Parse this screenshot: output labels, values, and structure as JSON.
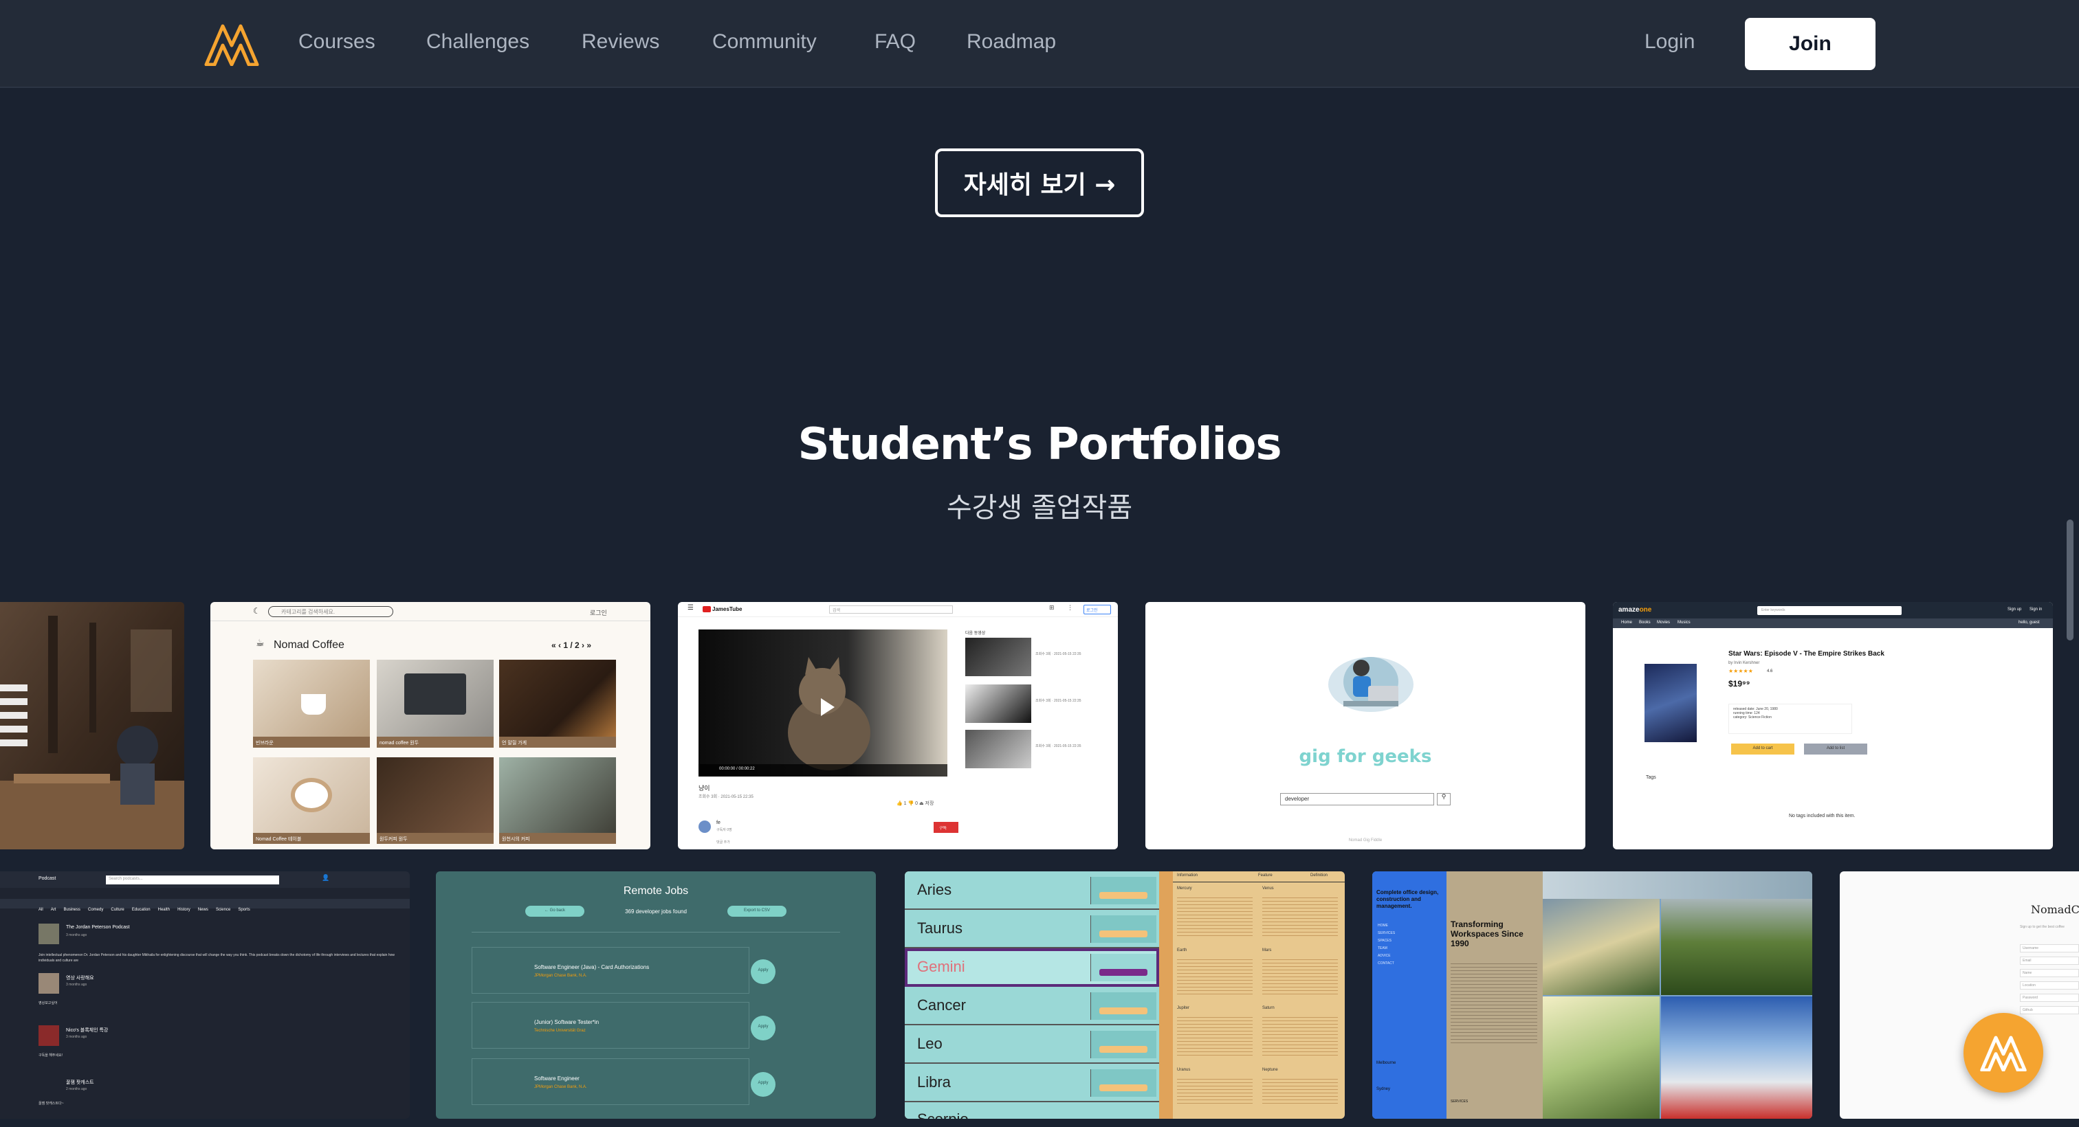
{
  "nav": {
    "links": [
      "Courses",
      "Challenges",
      "Reviews",
      "Community",
      "FAQ",
      "Roadmap"
    ],
    "login": "Login",
    "join": "Join"
  },
  "more_button": "자세히 보기 →",
  "section": {
    "title": "Student’s Portfolios",
    "subtitle": "수강생 졸업작품"
  },
  "colors": {
    "background": "#1a2230",
    "nav_background": "#232b38",
    "accent": "#f5a430"
  },
  "cards": {
    "nomad_coffee": {
      "search_placeholder": "카테고리를 검색하세요.",
      "login": "로그인",
      "title": "Nomad Coffee",
      "pager": "« ‹ 1 / 2 › »",
      "captions": [
        "빈브라운",
        "nomad coffee 원두",
        "언 말릴 가게",
        "Nomad Coffee 테이블",
        "원두커피 원두",
        "원천시의 커피"
      ]
    },
    "jamestube": {
      "logo": "JamesTube",
      "search": "검색",
      "login": "로그인",
      "video_title": "냥이",
      "video_meta": "조회수 3회 · 2021-05-15 22:35",
      "time": "00:00:00 / 00:00:22",
      "channel": "fe",
      "subscribers": "구독자 0명",
      "sidebar_title": "다음 동영상",
      "sidebar_meta": "조회수 3회 · 2021-05-15 22:35",
      "subscribe": "구독",
      "comment_hint": "댓글 추가",
      "actions": "👍 1  👎 0  ⏏ 저장"
    },
    "gig_for_geeks": {
      "title": "gig for geeks",
      "search_value": "developer",
      "footer": "Nomad Gig Fiddle"
    },
    "amazeone": {
      "logo_pre": "amaze",
      "logo_post": "one",
      "search": "Enter keywords",
      "nav_links": [
        "Home",
        "Books",
        "Movies",
        "Musics"
      ],
      "signup": "Sign up",
      "signin": "Sign in",
      "hello": "hello, guest",
      "product_title": "Star Wars: Episode V - The Empire Strikes Back",
      "author": "by Irvin Kershner",
      "rating": "4.6",
      "price": "$19⁹⁹",
      "details": [
        "released date: June 20, 1980",
        "running time: 124",
        "category: Science Fiction"
      ],
      "add_to_cart": "Add to cart",
      "add_to_list": "Add to list",
      "tags": "Tags",
      "no_tags": "No tags included with this item."
    },
    "podcast": {
      "brand": "Podcast",
      "search": "Search podcasts...",
      "categories": [
        "All",
        "Art",
        "Business",
        "Comedy",
        "Culture",
        "Education",
        "Health",
        "History",
        "News",
        "Science",
        "Sports"
      ],
      "items": [
        {
          "title": "The Jordan Peterson Podcast",
          "ago": "3 months ago",
          "desc": "Join intellectual phenomenon Dr. Jordan Peterson and his daughter Mikhaila for enlightening discourse that will change the way you think. This podcast breaks down the dichotomy of life through interviews and lectures that explain how individuals and culture are"
        },
        {
          "title": "영상 사랑해요",
          "ago": "3 months ago",
          "desc": "영상보고싶어"
        },
        {
          "title": "Nico's 블록체인 특강",
          "ago": "3 months ago",
          "desc": "구독을 해주세요!"
        },
        {
          "title": "꿀잼 팟캐스트",
          "ago": "2 months ago",
          "desc": "꿀잼 팟캐스트다~"
        }
      ]
    },
    "remote_jobs": {
      "title": "Remote Jobs",
      "go_back": "← Go back",
      "count": "369 developer jobs found",
      "export": "Export to CSV",
      "jobs": [
        {
          "title": "Software Engineer (Java) - Card Authorizations",
          "company": "JPMorgan Chase Bank, N.A."
        },
        {
          "title": "(Junior) Software Tester*in",
          "company": "Technische Universität Graz"
        },
        {
          "title": "Software Engineer",
          "company": "JPMorgan Chase Bank, N.A."
        }
      ],
      "apply": "Apply"
    },
    "zodiac": {
      "signs": [
        "Aries",
        "Taurus",
        "Gemini",
        "Cancer",
        "Leo",
        "Libra",
        "Scorpio"
      ],
      "tabs": [
        "Information",
        "Feature",
        "Definition"
      ],
      "planets": [
        "Mercury",
        "Venus",
        "Earth",
        "Mars",
        "Jupiter",
        "Saturn",
        "Uranus",
        "Neptune"
      ]
    },
    "office": {
      "tagline": "Complete office design, construction and management.",
      "menu": [
        "HOME",
        "SERVICES",
        "SPACES",
        "TEAM",
        "ADVICE",
        "CONTACT"
      ],
      "heading": "Transforming Workspaces Since 1990",
      "cities": [
        "Melbourne",
        "Sydney"
      ],
      "services": "SERVICES"
    },
    "nomad_coffee_login": {
      "title": "NomadCoffee",
      "subtitle": "Sign up to get the best coffee",
      "fields": [
        "Username",
        "Email",
        "Name",
        "Location",
        "Password",
        "Github"
      ]
    }
  }
}
